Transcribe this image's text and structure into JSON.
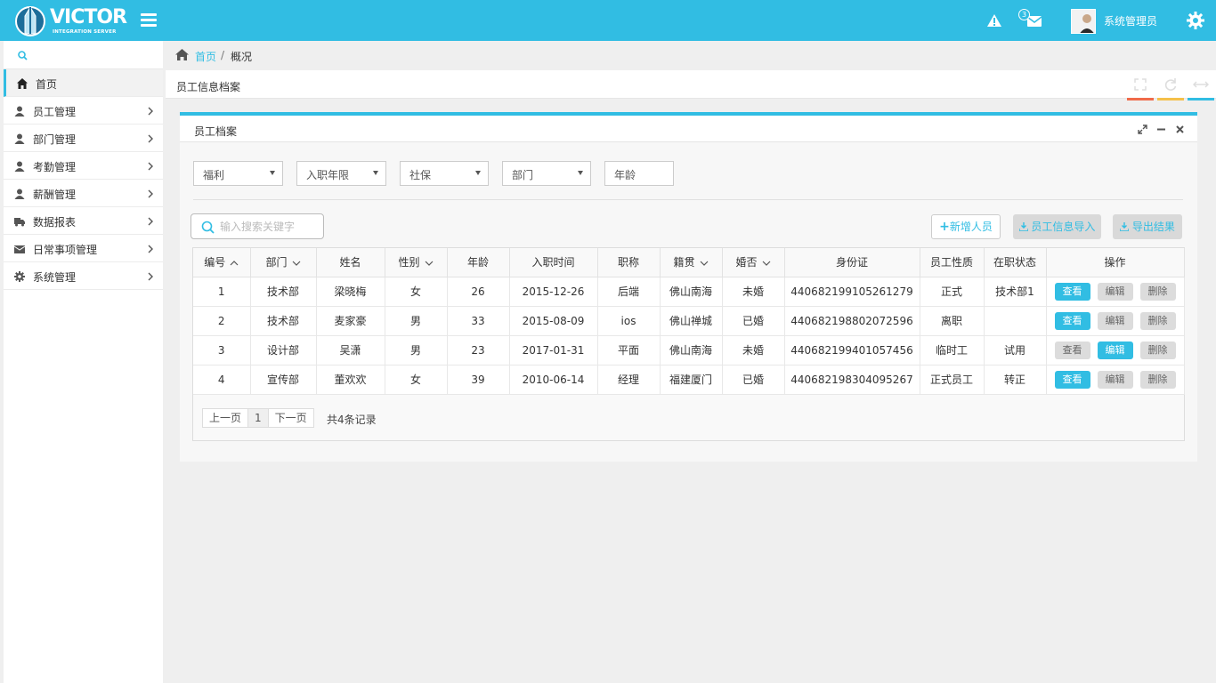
{
  "header": {
    "logo_text": "VICTOR",
    "logo_sub": "INTEGRATION SERVER",
    "mail_count": "3",
    "user_name": "系统管理员",
    "accent_color": "#31bde3"
  },
  "sidebar": {
    "items": [
      {
        "label": "首页",
        "icon": "home-icon",
        "active": true
      },
      {
        "label": "员工管理",
        "icon": "user-icon"
      },
      {
        "label": "部门管理",
        "icon": "user-icon"
      },
      {
        "label": "考勤管理",
        "icon": "user-icon"
      },
      {
        "label": "薪酬管理",
        "icon": "user-icon"
      },
      {
        "label": "数据报表",
        "icon": "truck-icon"
      },
      {
        "label": "日常事项管理",
        "icon": "envelope-icon"
      },
      {
        "label": "系统管理",
        "icon": "gear-icon"
      }
    ]
  },
  "breadcrumb": {
    "home": "首页",
    "sep": "/",
    "current": "概况"
  },
  "tab": {
    "title": "员工信息档案"
  },
  "panel": {
    "title": "员工档案",
    "filters": [
      "福利",
      "入职年限",
      "社保",
      "部门"
    ],
    "age_placeholder": "年龄",
    "search_placeholder": "输入搜索关键字",
    "add_label": "新增人员",
    "import_label": "员工信息导入",
    "export_label": "导出结果"
  },
  "table": {
    "headers": [
      "编号",
      "部门",
      "姓名",
      "性别",
      "年龄",
      "入职时间",
      "职称",
      "籍贯",
      "婚否",
      "身份证",
      "员工性质",
      "在职状态",
      "操作"
    ],
    "rows": [
      [
        "1",
        "技术部",
        "梁晓梅",
        "女",
        "26",
        "2015-12-26",
        "后端",
        "佛山南海",
        "未婚",
        "440682199105261279",
        "正式",
        "技术部1"
      ],
      [
        "2",
        "技术部",
        "麦家豪",
        "男",
        "33",
        "2015-08-09",
        "ios",
        "佛山禅城",
        "已婚",
        "440682198802072596",
        "离职",
        ""
      ],
      [
        "3",
        "设计部",
        "吴潇",
        "男",
        "23",
        "2017-01-31",
        "平面",
        "佛山南海",
        "未婚",
        "440682199401057456",
        "临时工",
        "试用"
      ],
      [
        "4",
        "宣传部",
        "董欢欢",
        "女",
        "39",
        "2010-06-14",
        "经理",
        "福建厦门",
        "已婚",
        "440682198304095267",
        "正式员工",
        "转正"
      ]
    ],
    "ops": {
      "view": "查看",
      "edit": "编辑",
      "delete": "删除"
    },
    "highlight": [
      "view",
      "view",
      "edit",
      "view"
    ]
  },
  "pager": {
    "prev": "上一页",
    "page": "1",
    "next": "下一页",
    "total": "共4条记录"
  }
}
